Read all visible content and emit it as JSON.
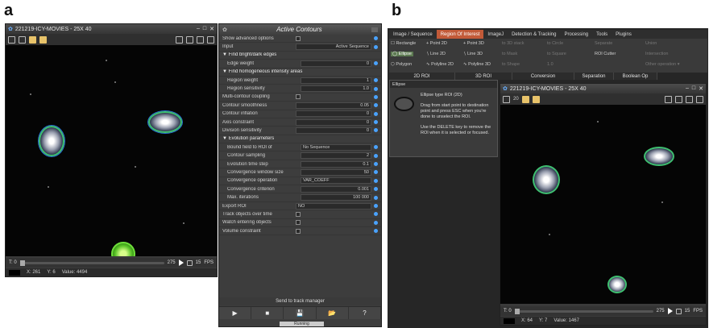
{
  "labels": {
    "a": "a",
    "b": "b"
  },
  "win_a": {
    "title": "221219-ICY-MOVIES - 25X 40",
    "slider": {
      "t_label": "T: 0",
      "t_end": "275",
      "fps": "15",
      "fps_unit": "FPS"
    },
    "status": {
      "x": "X: 261",
      "y": "Y: 6",
      "value": "Value: 4494"
    }
  },
  "ac": {
    "title": "Active Contours",
    "rows": [
      {
        "label": "Show advanced options",
        "type": "check"
      },
      {
        "label": "Input",
        "type": "field",
        "value": "Active Sequence"
      },
      {
        "label": "▼ Find bright/dark edges",
        "type": "section"
      },
      {
        "label": "Edge weight",
        "type": "field",
        "value": "0",
        "indent": true
      },
      {
        "label": "▼ Find homogeneous intensity areas",
        "type": "section"
      },
      {
        "label": "Region weight",
        "type": "field",
        "value": "1",
        "indent": true
      },
      {
        "label": "Region sensitivity",
        "type": "field",
        "value": "1.0",
        "indent": true
      },
      {
        "label": "Multi-contour coupling",
        "type": "check"
      },
      {
        "label": "Contour smoothness",
        "type": "field",
        "value": "0.05"
      },
      {
        "label": "Contour inflation",
        "type": "field",
        "value": "0"
      },
      {
        "label": "Axis constraint",
        "type": "field",
        "value": "0"
      },
      {
        "label": "Division sensitivity",
        "type": "field",
        "value": "0"
      },
      {
        "label": "▼ Evolution parameters",
        "type": "section"
      },
      {
        "label": "Bound field to ROI of",
        "type": "field",
        "value": "No Sequence",
        "left": true,
        "indent": true
      },
      {
        "label": "Contour sampling",
        "type": "field",
        "value": "2",
        "indent": true
      },
      {
        "label": "Evolution time step",
        "type": "field",
        "value": "0.1",
        "indent": true
      },
      {
        "label": "Convergence window size",
        "type": "field",
        "value": "50",
        "indent": true
      },
      {
        "label": "Convergence operation",
        "type": "field",
        "value": "VAR_COEFF",
        "left": true,
        "indent": true
      },
      {
        "label": "Convergence criterion",
        "type": "field",
        "value": "0.001",
        "indent": true
      },
      {
        "label": "Max. iterations",
        "type": "field",
        "value": "100 000",
        "indent": true
      },
      {
        "label": "Export ROI",
        "type": "field",
        "value": "NO",
        "left": true
      },
      {
        "label": "Track objects over time",
        "type": "check"
      },
      {
        "label": "Watch entering objects",
        "type": "check"
      },
      {
        "label": "Volume constraint",
        "type": "check"
      }
    ],
    "send_label": "Send to track manager",
    "buttons": [
      "▶",
      "■",
      "💾",
      "📂",
      "?"
    ],
    "running_label": "Running"
  },
  "menubar": [
    "Image / Sequence",
    "Region Of Interest",
    "ImageJ",
    "Detection & Tracking",
    "Processing",
    "Tools",
    "Plugins"
  ],
  "menubar_active": 1,
  "ribbon": {
    "items": [
      {
        "label": "☐ Rectangle",
        "col": 0,
        "row": 0
      },
      {
        "label": "◯ Ellipse",
        "col": 0,
        "row": 1,
        "sel": true
      },
      {
        "label": "⬡ Polygon",
        "col": 0,
        "row": 2
      },
      {
        "label": "+ Point 2D",
        "col": 1,
        "row": 0
      },
      {
        "label": "∖ Line 2D",
        "col": 1,
        "row": 1
      },
      {
        "label": "∿ Polyline 2D",
        "col": 1,
        "row": 2
      },
      {
        "label": "+ Point 3D",
        "col": 2,
        "row": 0
      },
      {
        "label": "∖ Line 3D",
        "col": 2,
        "row": 1
      },
      {
        "label": "∿ Polyline 3D",
        "col": 2,
        "row": 2
      },
      {
        "label": "to 3D stack",
        "col": 3,
        "row": 0,
        "dim": true
      },
      {
        "label": "to Mask",
        "col": 3,
        "row": 1,
        "dim": true
      },
      {
        "label": "to Shape",
        "col": 3,
        "row": 2,
        "dim": true
      },
      {
        "label": "to Circle",
        "col": 4,
        "row": 0,
        "dim": true
      },
      {
        "label": "to Square",
        "col": 4,
        "row": 1,
        "dim": true
      },
      {
        "label": "1.0",
        "col": 4,
        "row": 2,
        "dim": true
      },
      {
        "label": "Separate",
        "col": 5,
        "row": 0,
        "dim": true
      },
      {
        "label": "ROI Cutter",
        "col": 5,
        "row": 1
      },
      {
        "label": "Union",
        "col": 6,
        "row": 0,
        "dim": true
      },
      {
        "label": "Intersection",
        "col": 6,
        "row": 1,
        "dim": true
      },
      {
        "label": "Other operation ▾",
        "col": 6,
        "row": 2,
        "dim": true
      }
    ],
    "groups": [
      "2D ROI",
      "3D ROI",
      "Conversion",
      "Separation",
      "Boolean Op"
    ]
  },
  "tip": {
    "title": "Ellipse",
    "heading": "Ellipse type ROI (2D)",
    "body1": "Drag from start point to destination point and press ESC when you're done to unselect the ROI.",
    "body2": "Use the DELETE key to remove the ROI when it is selected or focused."
  },
  "win_b": {
    "title": "221219-ICY-MOVIES - 25X 40",
    "zoom": "20",
    "slider": {
      "t_label": "T: 0",
      "t_end": "275",
      "fps": "15",
      "fps_unit": "FPS"
    },
    "status": {
      "x": "X: 64",
      "y": "Y: 7",
      "value": "Value: 1467"
    }
  }
}
